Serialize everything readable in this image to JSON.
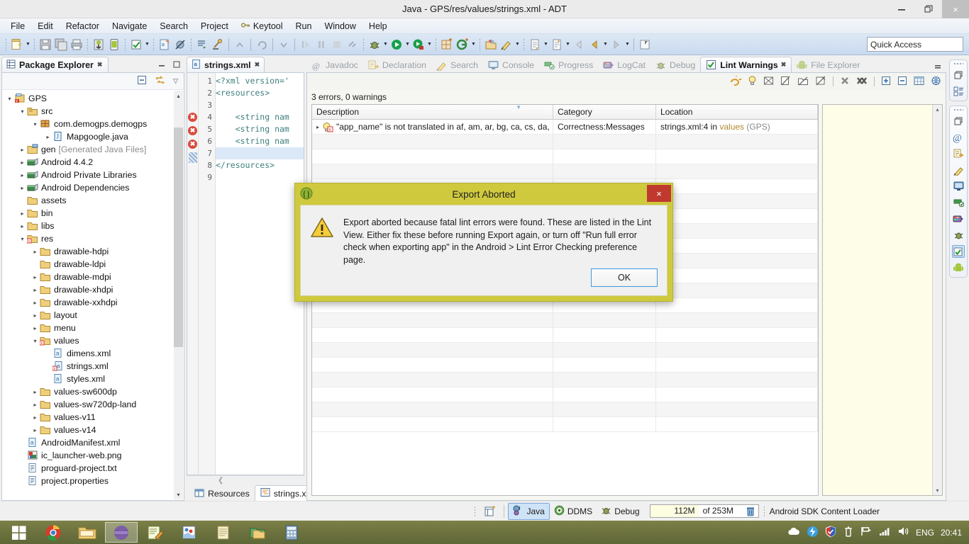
{
  "window": {
    "title": "Java - GPS/res/values/strings.xml - ADT",
    "minimize": "—",
    "restore": "❐",
    "close": "×"
  },
  "menubar": {
    "items": [
      {
        "label": "File",
        "icon": ""
      },
      {
        "label": "Edit",
        "icon": ""
      },
      {
        "label": "Refactor",
        "icon": ""
      },
      {
        "label": "Navigate",
        "icon": ""
      },
      {
        "label": "Search",
        "icon": ""
      },
      {
        "label": "Project",
        "icon": ""
      },
      {
        "label": "Keytool",
        "icon": "key-icon"
      },
      {
        "label": "Run",
        "icon": ""
      },
      {
        "label": "Window",
        "icon": ""
      },
      {
        "label": "Help",
        "icon": ""
      }
    ]
  },
  "toolbar": {
    "quick_access_placeholder": "Quick Access",
    "quick_access_value": ""
  },
  "package_explorer": {
    "tab_label": "Package Explorer",
    "tab_close": "✖",
    "minimize_label": "━",
    "maximize_label": "❐",
    "collapse_all": "collapse-all-icon",
    "link_with_editor": "link-with-editor-icon",
    "view_menu": "▽",
    "tree": [
      {
        "indent": 0,
        "arrow": "▾",
        "icon": "android-project-icon",
        "label": "GPS",
        "dim": ""
      },
      {
        "indent": 1,
        "arrow": "▾",
        "icon": "source-folder-icon",
        "label": "src",
        "dim": ""
      },
      {
        "indent": 2,
        "arrow": "▾",
        "icon": "package-icon",
        "label": "com.demogps.demogps",
        "dim": ""
      },
      {
        "indent": 3,
        "arrow": "▸",
        "icon": "java-file-icon",
        "label": "Mapgoogle.java",
        "dim": ""
      },
      {
        "indent": 1,
        "arrow": "▸",
        "icon": "gen-folder-icon",
        "label": "gen",
        "dim": "[Generated Java Files]"
      },
      {
        "indent": 1,
        "arrow": "▸",
        "icon": "library-icon",
        "label": "Android 4.4.2",
        "dim": ""
      },
      {
        "indent": 1,
        "arrow": "▸",
        "icon": "library-icon",
        "label": "Android Private Libraries",
        "dim": ""
      },
      {
        "indent": 1,
        "arrow": "▸",
        "icon": "library-icon",
        "label": "Android Dependencies",
        "dim": ""
      },
      {
        "indent": 1,
        "arrow": "",
        "icon": "folder-icon",
        "label": "assets",
        "dim": ""
      },
      {
        "indent": 1,
        "arrow": "▸",
        "icon": "folder-icon",
        "label": "bin",
        "dim": ""
      },
      {
        "indent": 1,
        "arrow": "▸",
        "icon": "folder-icon",
        "label": "libs",
        "dim": ""
      },
      {
        "indent": 1,
        "arrow": "▾",
        "icon": "folder-error-icon",
        "label": "res",
        "dim": ""
      },
      {
        "indent": 2,
        "arrow": "▸",
        "icon": "folder-icon",
        "label": "drawable-hdpi",
        "dim": ""
      },
      {
        "indent": 2,
        "arrow": "",
        "icon": "folder-icon",
        "label": "drawable-ldpi",
        "dim": ""
      },
      {
        "indent": 2,
        "arrow": "▸",
        "icon": "folder-icon",
        "label": "drawable-mdpi",
        "dim": ""
      },
      {
        "indent": 2,
        "arrow": "▸",
        "icon": "folder-icon",
        "label": "drawable-xhdpi",
        "dim": ""
      },
      {
        "indent": 2,
        "arrow": "▸",
        "icon": "folder-icon",
        "label": "drawable-xxhdpi",
        "dim": ""
      },
      {
        "indent": 2,
        "arrow": "▸",
        "icon": "folder-icon",
        "label": "layout",
        "dim": ""
      },
      {
        "indent": 2,
        "arrow": "▸",
        "icon": "folder-icon",
        "label": "menu",
        "dim": ""
      },
      {
        "indent": 2,
        "arrow": "▾",
        "icon": "folder-error-icon",
        "label": "values",
        "dim": ""
      },
      {
        "indent": 3,
        "arrow": "",
        "icon": "xml-file-icon",
        "label": "dimens.xml",
        "dim": ""
      },
      {
        "indent": 3,
        "arrow": "",
        "icon": "xml-error-file-icon",
        "label": "strings.xml",
        "dim": ""
      },
      {
        "indent": 3,
        "arrow": "",
        "icon": "xml-file-icon",
        "label": "styles.xml",
        "dim": ""
      },
      {
        "indent": 2,
        "arrow": "▸",
        "icon": "folder-icon",
        "label": "values-sw600dp",
        "dim": ""
      },
      {
        "indent": 2,
        "arrow": "▸",
        "icon": "folder-icon",
        "label": "values-sw720dp-land",
        "dim": ""
      },
      {
        "indent": 2,
        "arrow": "▸",
        "icon": "folder-icon",
        "label": "values-v11",
        "dim": ""
      },
      {
        "indent": 2,
        "arrow": "▸",
        "icon": "folder-icon",
        "label": "values-v14",
        "dim": ""
      },
      {
        "indent": 1,
        "arrow": "",
        "icon": "xml-file-icon",
        "label": "AndroidManifest.xml",
        "dim": ""
      },
      {
        "indent": 1,
        "arrow": "",
        "icon": "png-file-icon",
        "label": "ic_launcher-web.png",
        "dim": ""
      },
      {
        "indent": 1,
        "arrow": "",
        "icon": "text-file-icon",
        "label": "proguard-project.txt",
        "dim": ""
      },
      {
        "indent": 1,
        "arrow": "",
        "icon": "text-file-icon",
        "label": "project.properties",
        "dim": ""
      }
    ]
  },
  "editor": {
    "tab_label": "strings.xml",
    "tab_close": "✖",
    "lines": [
      {
        "n": "1",
        "marker": "",
        "text": "<?xml version='",
        "cls": "k-decl"
      },
      {
        "n": "2",
        "marker": "",
        "text": "<resources>",
        "cls": "k-tag"
      },
      {
        "n": "3",
        "marker": "",
        "text": "",
        "cls": ""
      },
      {
        "n": "4",
        "marker": "error",
        "text": "    <string nam",
        "cls": "k-tag"
      },
      {
        "n": "5",
        "marker": "error",
        "text": "    <string nam",
        "cls": "k-tag"
      },
      {
        "n": "6",
        "marker": "error",
        "text": "    <string nam",
        "cls": "k-tag"
      },
      {
        "n": "7",
        "marker": "caret",
        "text": "",
        "cls": ""
      },
      {
        "n": "8",
        "marker": "",
        "text": "</resources>",
        "cls": "k-tag"
      },
      {
        "n": "9",
        "marker": "",
        "text": "",
        "cls": ""
      }
    ],
    "bottom_tabs": [
      {
        "label": "Resources",
        "icon": "resources-table-icon",
        "active": false
      },
      {
        "label": "strings.xml",
        "icon": "xml-source-icon",
        "active": true
      }
    ]
  },
  "views": {
    "tabs": [
      {
        "label": "Javadoc",
        "icon": "javadoc-at-icon",
        "active": false
      },
      {
        "label": "Declaration",
        "icon": "declaration-icon",
        "active": false
      },
      {
        "label": "Search",
        "icon": "search-icon",
        "active": false
      },
      {
        "label": "Console",
        "icon": "console-icon",
        "active": false
      },
      {
        "label": "Progress",
        "icon": "progress-icon",
        "active": false
      },
      {
        "label": "LogCat",
        "icon": "logcat-icon",
        "active": false
      },
      {
        "label": "Debug",
        "icon": "debug-bug-icon",
        "active": false
      },
      {
        "label": "Lint Warnings",
        "icon": "lint-check-icon",
        "active": true
      },
      {
        "label": "File Explorer",
        "icon": "android-robot-icon",
        "active": false
      }
    ],
    "active_tab_close": "✖",
    "view_menu": "▽",
    "minimize": "━"
  },
  "lint": {
    "summary": "3 errors, 0 warnings",
    "toolbar_icons": [
      "refresh-lint-icon",
      "quickfix-bulb-icon",
      "ignore-icon",
      "ignore-file-icon",
      "ignore-project-icon",
      "ignore-all-icon",
      "remove-icon",
      "remove-all-icon",
      "expand-all-icon",
      "collapse-all-icon",
      "columns-icon",
      "configure-icon"
    ],
    "columns": [
      {
        "label": "Description",
        "sorted": true
      },
      {
        "label": "Category",
        "sorted": false
      },
      {
        "label": "Location",
        "sorted": false
      }
    ],
    "rows": [
      {
        "expander": "▸",
        "icon": "lint-error-icon",
        "description": "\"app_name\" is not translated in af, am, ar, bg, ca, cs, da,",
        "category": "Correctness:Messages",
        "location": "strings.xml:4 in ",
        "location_link": "values",
        "location_suffix": " (GPS)"
      }
    ],
    "empty_rows": 20,
    "scroll_up": "▴",
    "scroll_down": "▾"
  },
  "statusbar": {
    "writable_icon": "new-editor-icon",
    "perspectives": [
      {
        "label": "Java",
        "icon": "java-perspective-icon",
        "selected": true
      },
      {
        "label": "DDMS",
        "icon": "ddms-icon",
        "selected": false
      },
      {
        "label": "Debug",
        "icon": "debug-perspective-icon",
        "selected": false
      }
    ],
    "heap_used": "112M",
    "heap_total": "of 253M",
    "trash_icon": "trash-icon",
    "task_text": "Android SDK Content Loader"
  },
  "dialog": {
    "title": "Export Aborted",
    "title_icon": "eclipse-adt-icon",
    "close_label": "×",
    "warning_icon": "warning-triangle-icon",
    "message": "Export aborted because fatal lint errors were found. These are listed in the Lint View. Either fix these before running Export again, or turn off \"Run full error check when exporting app\" in the Android > Lint Error Checking preference page.",
    "ok_label": "OK"
  },
  "taskbar": {
    "buttons": [
      {
        "name": "start-button",
        "icon": "windows-start-icon",
        "active": false
      },
      {
        "name": "chrome",
        "icon": "chrome-icon",
        "active": false
      },
      {
        "name": "file-explorer",
        "icon": "folder-explorer-icon",
        "active": false
      },
      {
        "name": "eclipse",
        "icon": "eclipse-icon",
        "active": true
      },
      {
        "name": "editor-app",
        "icon": "notepad-pencil-icon",
        "active": false
      },
      {
        "name": "paint-app",
        "icon": "paint-icon",
        "active": false
      },
      {
        "name": "notepad-app",
        "icon": "notepad-icon",
        "active": false
      },
      {
        "name": "folders-app",
        "icon": "folders-icon",
        "active": false
      },
      {
        "name": "calculator-app",
        "icon": "calculator-icon",
        "active": false
      }
    ],
    "tray": [
      {
        "name": "onedrive-icon"
      },
      {
        "name": "antivirus-icon"
      },
      {
        "name": "security-shield-icon"
      },
      {
        "name": "battery-icon"
      },
      {
        "name": "flag-icon"
      },
      {
        "name": "network-icon"
      },
      {
        "name": "volume-icon"
      }
    ],
    "language": "ENG",
    "clock": "20:41"
  }
}
